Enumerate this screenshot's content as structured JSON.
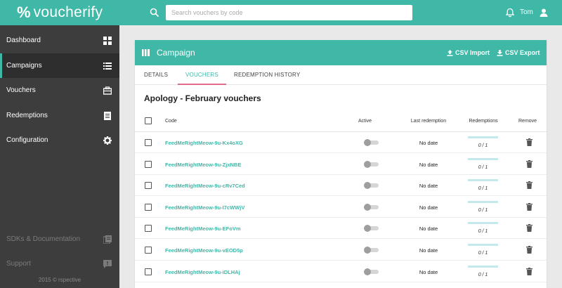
{
  "app": {
    "logo_mark": "%",
    "logo_text": "voucherify"
  },
  "search": {
    "placeholder": "Search vouchers by code"
  },
  "user": {
    "name": "Tom"
  },
  "sidebar": {
    "items": [
      {
        "label": "Dashboard",
        "icon": "dashboard-icon"
      },
      {
        "label": "Campaigns",
        "icon": "list-icon",
        "active": true
      },
      {
        "label": "Vouchers",
        "icon": "voucher-icon"
      },
      {
        "label": "Redemptions",
        "icon": "document-icon"
      },
      {
        "label": "Configuration",
        "icon": "gear-icon"
      }
    ],
    "secondary": [
      {
        "label": "SDKs & Documentation",
        "icon": "docs-icon"
      },
      {
        "label": "Support",
        "icon": "chat-icon"
      }
    ],
    "footer": "2015 © rspective"
  },
  "campaign": {
    "header_title": "Campaign",
    "csv_import": "CSV Import",
    "csv_export": "CSV Export",
    "tabs": [
      {
        "label": "DETAILS"
      },
      {
        "label": "VOUCHERS",
        "active": true
      },
      {
        "label": "REDEMPTION HISTORY"
      }
    ],
    "title": "Apology - February vouchers"
  },
  "table": {
    "headers": {
      "code": "Code",
      "active": "Active",
      "last_redemption": "Last redemption",
      "redemptions": "Redemptions",
      "remove": "Remove"
    },
    "rows": [
      {
        "code": "FeedMeRightMeow-9u-Kx4oXG",
        "last_redemption": "No date",
        "redemptions": "0 / 1",
        "redeemed_fraction": 0
      },
      {
        "code": "FeedMeRightMeow-9u-ZjxNBE",
        "last_redemption": "No date",
        "redemptions": "0 / 1",
        "redeemed_fraction": 0
      },
      {
        "code": "FeedMeRightMeow-9u-cRv7Ced",
        "last_redemption": "No date",
        "redemptions": "0 / 1",
        "redeemed_fraction": 0
      },
      {
        "code": "FeedMeRightMeow-9u-I7cWWjV",
        "last_redemption": "No date",
        "redemptions": "0 / 1",
        "redeemed_fraction": 0
      },
      {
        "code": "FeedMeRightMeow-9u-EFoVm",
        "last_redemption": "No date",
        "redemptions": "0 / 1",
        "redeemed_fraction": 0
      },
      {
        "code": "FeedMeRightMeow-9u-vEOD5p",
        "last_redemption": "No date",
        "redemptions": "0 / 1",
        "redeemed_fraction": 0
      },
      {
        "code": "FeedMeRightMeow-9u-iDLHAj",
        "last_redemption": "No date",
        "redemptions": "0 / 1",
        "redeemed_fraction": 0
      }
    ]
  },
  "colors": {
    "accent": "#3fb8a7",
    "sidebar": "#3d3d3d",
    "tab_underline": "#e26b8c"
  }
}
